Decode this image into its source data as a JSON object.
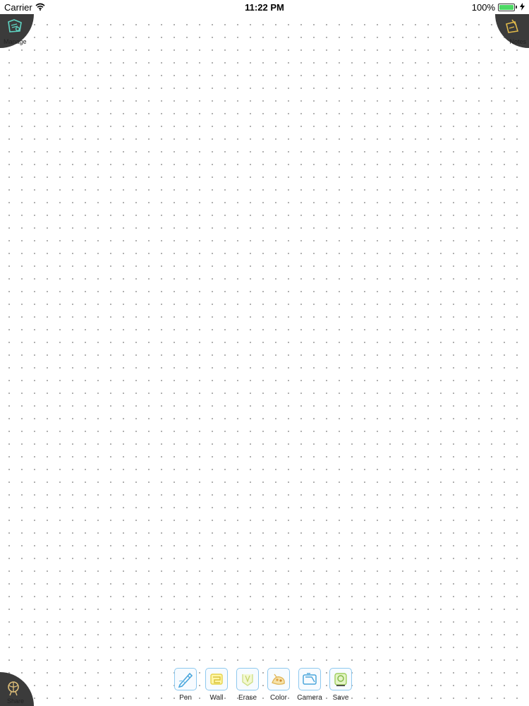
{
  "status_bar": {
    "carrier": "Carrier",
    "time": "11:22 PM",
    "battery": "100%"
  },
  "corners": {
    "manage": {
      "label": "Manage",
      "icon": "manage-folder-icon"
    },
    "notes": {
      "label": "Notes",
      "icon": "notes-pencil-icon"
    },
    "share": {
      "label": "Share",
      "icon": "share-globe-icon"
    }
  },
  "toolbar": {
    "pen": {
      "label": "Pen",
      "icon": "pen-icon"
    },
    "wall": {
      "label": "Wall",
      "icon": "wall-icon"
    },
    "erase": {
      "label": "Erase",
      "icon": "eraser-icon"
    },
    "color": {
      "label": "Color",
      "icon": "color-palette-icon"
    },
    "camera": {
      "label": "Camera",
      "icon": "camera-icon"
    },
    "save": {
      "label": "Save",
      "icon": "save-icon"
    }
  },
  "colors": {
    "corner_bg": "#3b3b3b",
    "tool_border": "#8ec9ef",
    "battery_fill": "#4cd964",
    "dot": "#9a9a9a"
  }
}
